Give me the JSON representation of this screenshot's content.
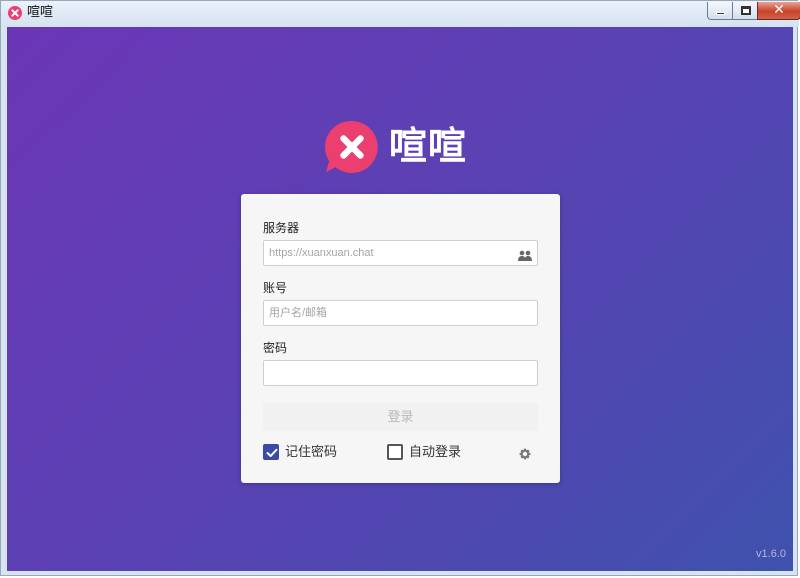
{
  "window": {
    "title": "喧喧",
    "close_symbol": "✕"
  },
  "brand": {
    "name": "喧喧"
  },
  "login_form": {
    "server_label": "服务器",
    "server_placeholder": "https://xuanxuan.chat",
    "server_value": "",
    "account_label": "账号",
    "account_placeholder": "用户名/邮箱",
    "account_value": "",
    "password_label": "密码",
    "password_value": "",
    "login_button": "登录",
    "remember_password_label": "记住密码",
    "remember_password_checked": true,
    "auto_login_label": "自动登录",
    "auto_login_checked": false
  },
  "icons": {
    "server_field_icon": "users-icon",
    "settings_icon": "gear-icon",
    "app_logo": "xuanxuan-logo-icon"
  },
  "footer": {
    "version": "v1.6.0"
  },
  "colors": {
    "background_start": "#6b36b6",
    "background_end": "#3f52ad",
    "brand_pink": "#ea3f6f",
    "checkbox_accent": "#3a4aa6"
  }
}
